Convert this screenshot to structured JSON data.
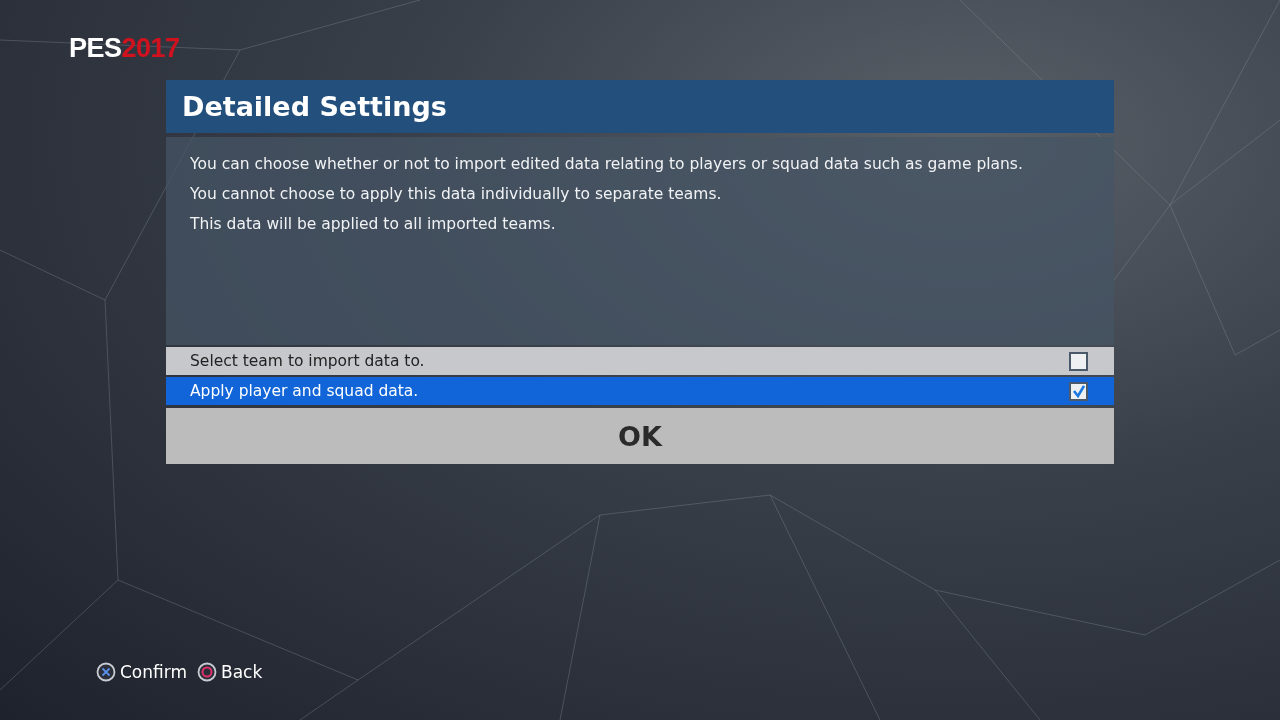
{
  "logo": {
    "brand": "PES",
    "year": "2017"
  },
  "dialog": {
    "title": "Detailed Settings",
    "description": [
      "You can choose whether or not to import edited data relating to players or squad data such as game plans.",
      "You cannot choose to apply this data individually to separate teams.",
      "This data will be applied to all imported teams."
    ],
    "options": [
      {
        "label": "Select team to import data to.",
        "selected": false,
        "checked": false
      },
      {
        "label": "Apply player and squad data.",
        "selected": true,
        "checked": true
      }
    ],
    "ok_button": "OK"
  },
  "footer_hints": [
    {
      "kind": "cross",
      "label": "Confirm"
    },
    {
      "kind": "circle",
      "label": "Back"
    }
  ]
}
